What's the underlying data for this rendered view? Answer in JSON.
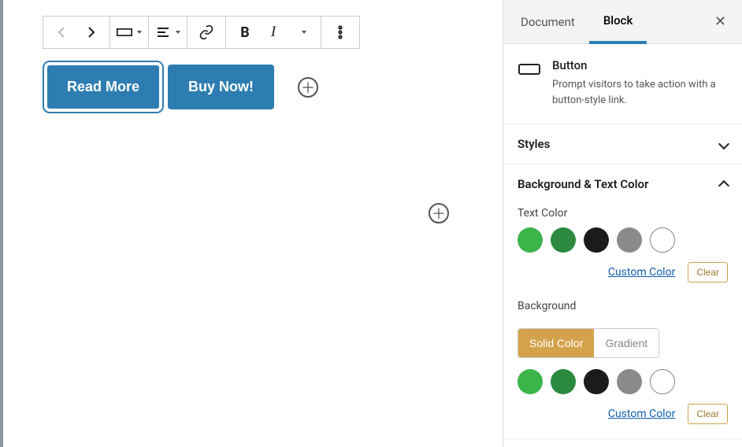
{
  "buttons_block": {
    "b1": "Read More",
    "b2": "Buy Now!"
  },
  "sidebar": {
    "tabs": {
      "document": "Document",
      "block": "Block"
    },
    "block_card": {
      "title": "Button",
      "desc": "Prompt visitors to take action with a button-style link."
    },
    "panels": {
      "styles": "Styles",
      "bgtext": "Background & Text Color"
    },
    "text_color": {
      "label": "Text Color",
      "custom": "Custom Color",
      "clear": "Clear"
    },
    "background": {
      "label": "Background",
      "solid": "Solid Color",
      "gradient": "Gradient",
      "custom": "Custom Color",
      "clear": "Clear"
    },
    "palette": {
      "c1": "#3bb54a",
      "c2": "#2b8a3e",
      "c3": "#1b1b1b",
      "c4": "#8a8a8a",
      "c5": "#ffffff"
    }
  }
}
